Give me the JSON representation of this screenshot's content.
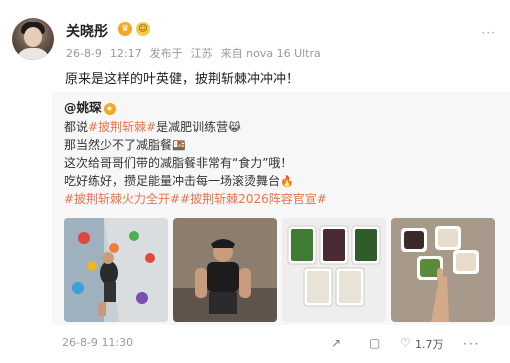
{
  "post": {
    "author": "关晓彤",
    "author_badge_icon": "crown-icon",
    "author_emoji_icon": "smile-badge-icon",
    "date": "26-8-9",
    "time": "12:17",
    "source_prefix": "发布于",
    "location": "江苏",
    "client": "来自 nova 16 Ultra",
    "more_label": "···",
    "text": "原来是这样的叶英健，披荆斩棘冲冲冲！"
  },
  "repost": {
    "author": "@姚琛",
    "line1_link": "#披荆斩棘#",
    "line1_text": "是减肥训练营",
    "line1_emoji": "😹",
    "line2_text": "那当然少不了减脂餐",
    "line2_emoji": "🍱",
    "line3_text": "这次给哥哥们带的减脂餐非常有“食力”哦！",
    "line4_text": "吃好练好，攒足能量冲击每一场滚烫舞台",
    "line4_emoji": "🔥",
    "line5_link1": "#披荆斩棘火力全开#",
    "line5_link2": "#披荆斩棘2026阵容官宣#",
    "line1_prefix": "都说"
  },
  "footer": {
    "date": "26-8-9",
    "time": "11:30",
    "like_count": "1.7万",
    "actions": "···"
  },
  "colors": {
    "link": "#eb7350",
    "meta": "#999999",
    "repost_bg": "#f7f7f7"
  }
}
